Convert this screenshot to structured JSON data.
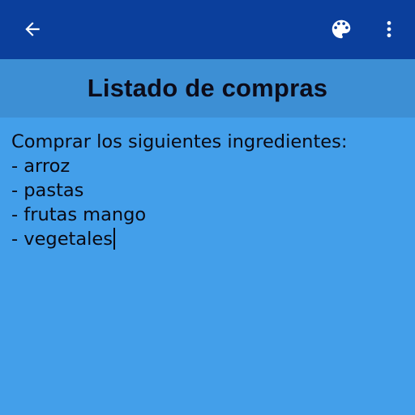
{
  "toolbar": {
    "back_icon": "arrow-left-icon",
    "palette_icon": "palette-icon",
    "more_icon": "more-vertical-icon",
    "background": "#0b3f9c",
    "icon_color": "#ffffff"
  },
  "note": {
    "title": "Listado de compras",
    "lines": [
      "Comprar los siguientes ingredientes:",
      "- arroz",
      "- pastas",
      "- frutas mango",
      "- vegetales"
    ],
    "title_bar_color": "#3d8fd4",
    "background_color": "#439fea"
  }
}
